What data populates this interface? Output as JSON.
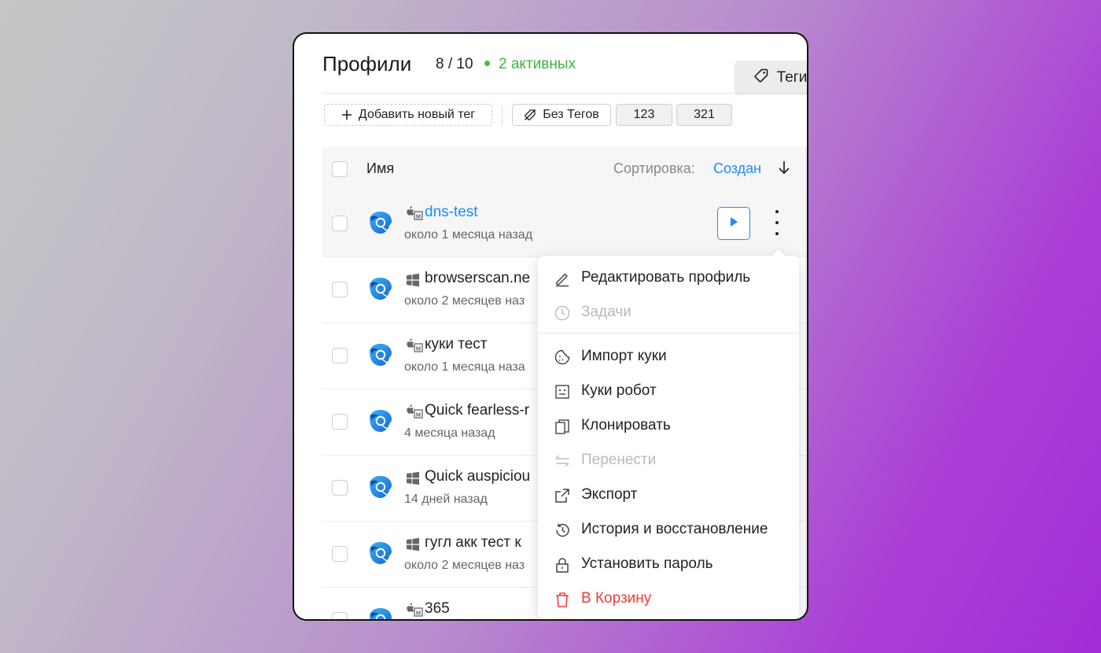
{
  "header": {
    "title": "Профили",
    "count": "8 / 10",
    "active": "2 активных",
    "tags_button": "Теги",
    "active_color": "#3fb33f"
  },
  "tagbar": {
    "add_tag": "Добавить новый тег",
    "no_tags": "Без Тегов",
    "tags": [
      "123",
      "321"
    ]
  },
  "table": {
    "column_name": "Имя",
    "sort_label": "Сортировка:",
    "sort_value": "Создан",
    "sort_direction": "arrow-down-icon",
    "accent": "#1d8cf8",
    "rows": [
      {
        "os": "macos-icon",
        "name": "dns-test",
        "sub": "около 1 месяца назад",
        "selected": true
      },
      {
        "os": "windows-icon",
        "name": "browserscan.ne",
        "sub": "около 2 месяцев наз"
      },
      {
        "os": "macos-icon",
        "name": "куки тест",
        "sub": "около 1 месяца наза"
      },
      {
        "os": "macos-icon",
        "name": "Quick fearless-r",
        "sub": "4 месяца назад"
      },
      {
        "os": "windows-icon",
        "name": "Quick auspiciou",
        "sub": "14 дней назад"
      },
      {
        "os": "windows-icon",
        "name": "гугл акк тест к",
        "sub": "около 2 месяцев наз"
      },
      {
        "os": "macos-icon",
        "name": "365",
        "sub": ""
      }
    ]
  },
  "menu": {
    "items": [
      {
        "label": "Редактировать профиль",
        "icon": "pencil-icon",
        "state": "normal"
      },
      {
        "label": "Задачи",
        "icon": "clock-icon",
        "state": "disabled"
      },
      {
        "label": "Импорт куки",
        "icon": "cookie-icon",
        "state": "normal"
      },
      {
        "label": "Куки робот",
        "icon": "robot-icon",
        "state": "normal"
      },
      {
        "label": "Клонировать",
        "icon": "copy-icon",
        "state": "normal"
      },
      {
        "label": "Перенести",
        "icon": "transfer-icon",
        "state": "disabled"
      },
      {
        "label": "Экспорт",
        "icon": "export-icon",
        "state": "normal"
      },
      {
        "label": "История и восстановление",
        "icon": "history-icon",
        "state": "normal"
      },
      {
        "label": "Установить пароль",
        "icon": "lock-icon",
        "state": "normal"
      },
      {
        "label": "В Корзину",
        "icon": "trash-icon",
        "state": "danger"
      }
    ],
    "danger_color": "#ee3b3b"
  }
}
